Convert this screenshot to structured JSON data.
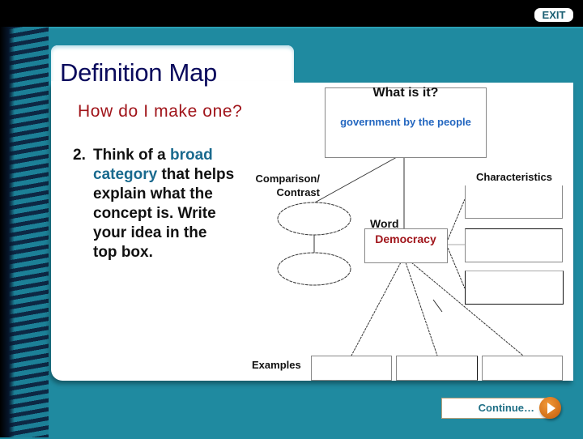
{
  "header": {
    "exit_label": "EXIT"
  },
  "slide": {
    "title": "Definition Map",
    "subtitle": "How do I make one?",
    "instruction": {
      "number": "2.",
      "text_before": "Think of a ",
      "highlight": "broad category",
      "text_after": "  that helps explain what the concept is.  Write your idea in the top box."
    }
  },
  "map": {
    "what_is_it": {
      "label": "What is it?",
      "value": "government by the people"
    },
    "comparison": {
      "label_line1": "Comparison/",
      "label_line2": "Contrast"
    },
    "characteristics": {
      "label": "Characteristics"
    },
    "word": {
      "label": "Word",
      "value": "Democracy"
    },
    "examples": {
      "label": "Examples"
    }
  },
  "footer": {
    "continue_label": "Continue…"
  },
  "colors": {
    "background_teal": "#1f8aa0",
    "title_navy": "#0a0a5c",
    "subtitle_red": "#a0141a",
    "highlight_blue": "#1a6a8e",
    "continue_orange": "#d86c12"
  }
}
